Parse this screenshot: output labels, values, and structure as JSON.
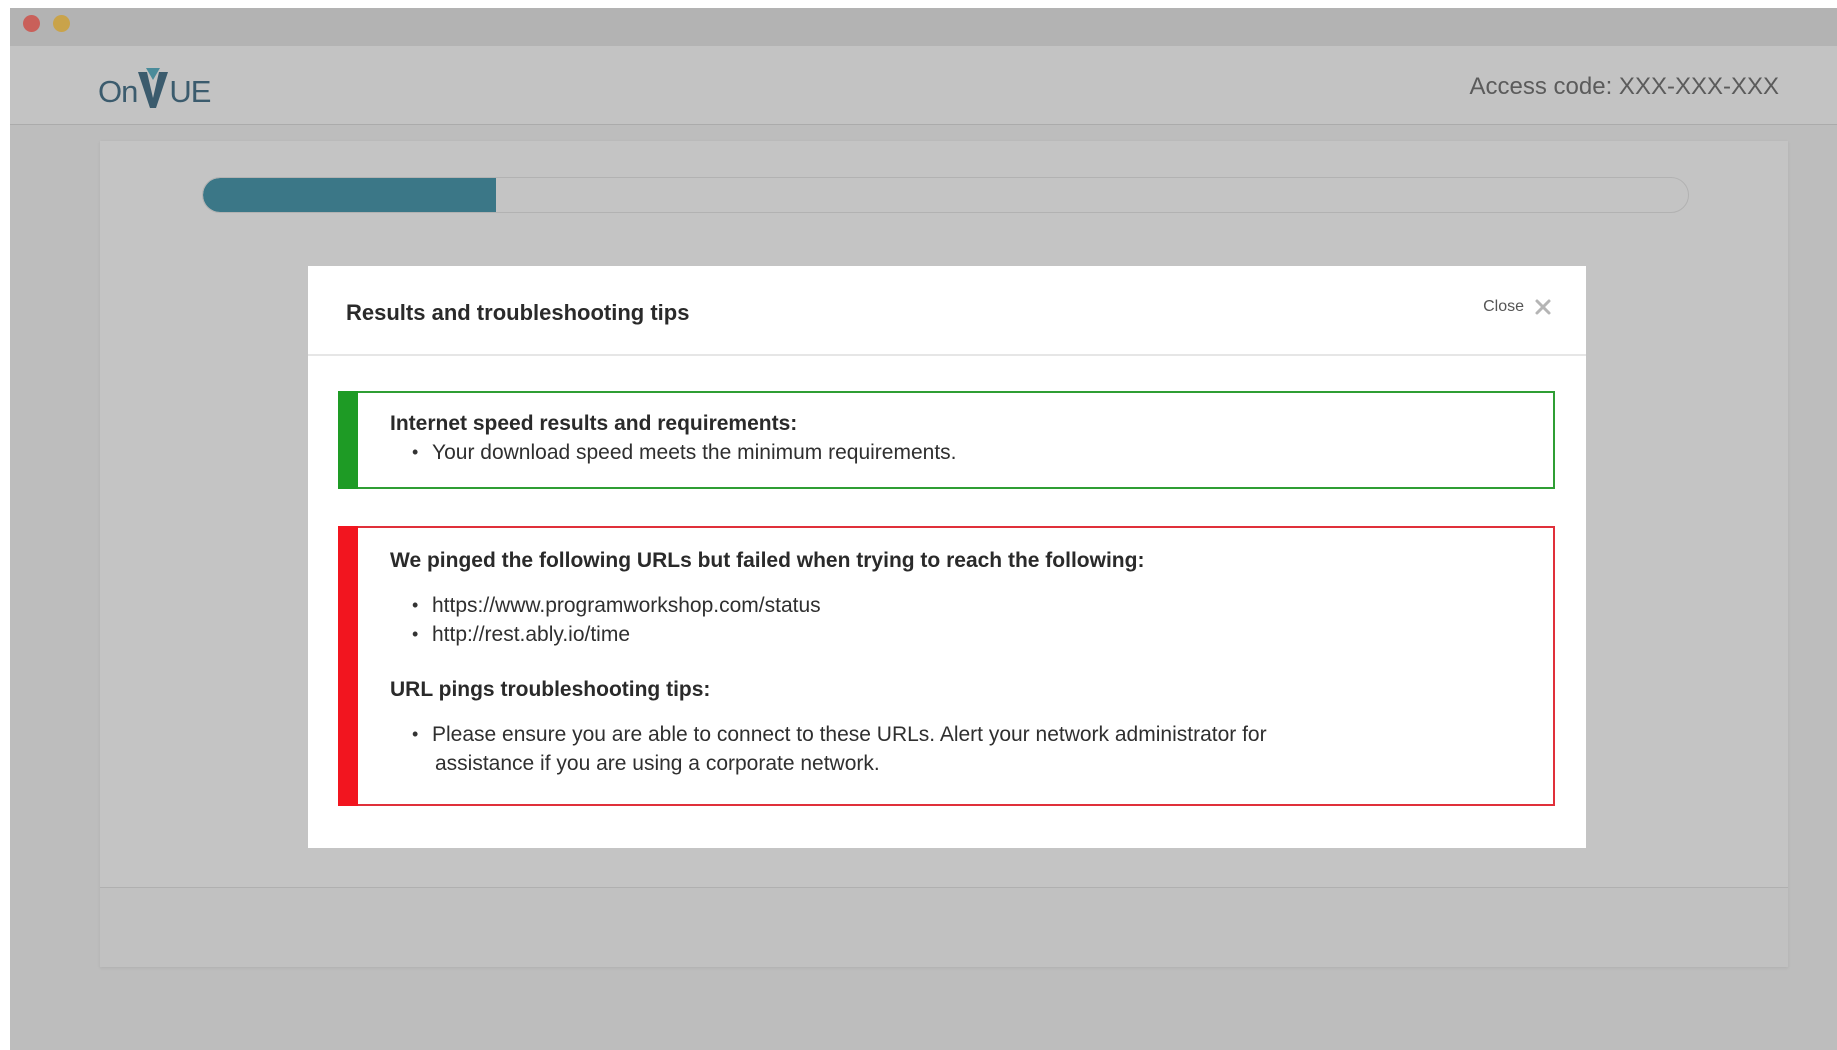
{
  "app": {
    "logo_text_left": "On",
    "logo_text_right": "UE",
    "access_code": "Access code: XXX-XXX-XXX"
  },
  "progress": {
    "fraction": 0.197,
    "fill_color": "#3b7787"
  },
  "modal": {
    "title": "Results and troubleshooting tips",
    "close_label": "Close",
    "close_icon": "close-icon"
  },
  "speed_result": {
    "status": "pass",
    "status_color": "#1e9b25",
    "heading": "Internet speed results and requirements:",
    "items": [
      "Your download speed meets the minimum requirements."
    ]
  },
  "url_result": {
    "status": "fail",
    "status_color": "#f2151f",
    "heading": "We pinged the following URLs but failed when trying to reach the following:",
    "urls": [
      "https://www.programworkshop.com/status",
      "http://rest.ably.io/time"
    ],
    "tips_heading": "URL pings troubleshooting tips:",
    "tips": [
      {
        "line1": "Please ensure you are able to connect to these URLs. Alert your network administrator for",
        "line2": "assistance if you are using a corporate network."
      }
    ]
  }
}
